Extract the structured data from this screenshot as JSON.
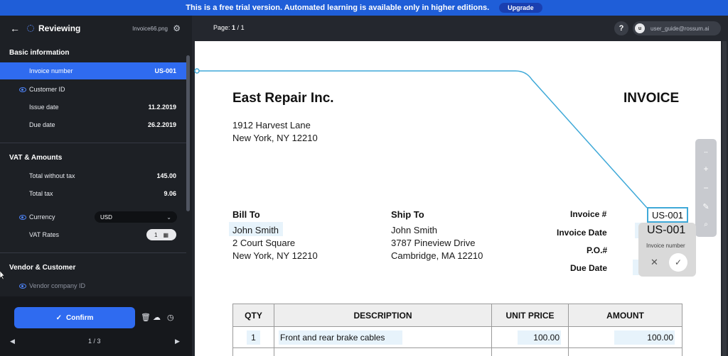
{
  "banner": {
    "text": "This is a free trial version. Automated learning is available only in higher editions.",
    "upgrade": "Upgrade"
  },
  "sidebar": {
    "title": "Reviewing",
    "filename": "Invoice66.png",
    "sections": {
      "basic": "Basic information",
      "vat": "VAT & Amounts",
      "vendor": "Vendor & Customer"
    },
    "fields": {
      "invoice_number": {
        "label": "Invoice number",
        "value": "US-001"
      },
      "customer_id": {
        "label": "Customer ID"
      },
      "issue_date": {
        "label": "Issue date",
        "value": "11.2.2019"
      },
      "due_date": {
        "label": "Due date",
        "value": "26.2.2019"
      },
      "total_wo_tax": {
        "label": "Total without tax",
        "value": "145.00"
      },
      "total_tax": {
        "label": "Total tax",
        "value": "9.06"
      },
      "currency": {
        "label": "Currency",
        "value": "USD"
      },
      "vat_rates": {
        "label": "VAT Rates",
        "value": "1"
      },
      "vendor_company_id": {
        "label": "Vendor company ID"
      }
    },
    "confirm": "Confirm",
    "pager": "1 / 3"
  },
  "docbar": {
    "page_label": "Page:",
    "page_current": "1",
    "page_total": "/ 1",
    "help": "?",
    "avatar": "u",
    "user": "user_guide@rossum.ai"
  },
  "invoice": {
    "company": "East Repair Inc.",
    "heading": "INVOICE",
    "address1": "1912 Harvest Lane",
    "address2": "New York, NY 12210",
    "bill_to": {
      "title": "Bill To",
      "name": "John Smith",
      "street": "2 Court Square",
      "city": "New York, NY 12210"
    },
    "ship_to": {
      "title": "Ship To",
      "name": "John Smith",
      "street": "3787 Pineview Drive",
      "city": "Cambridge, MA 12210"
    },
    "meta_labels": {
      "invoice_no": "Invoice #",
      "invoice_date": "Invoice Date",
      "po": "P.O.#",
      "due_date": "Due Date"
    },
    "invoice_no_value": "US-001",
    "table": {
      "headers": [
        "QTY",
        "DESCRIPTION",
        "UNIT PRICE",
        "AMOUNT"
      ],
      "rows": [
        [
          "1",
          "Front and rear brake cables",
          "100.00",
          "100.00"
        ]
      ]
    }
  },
  "edit_popup": {
    "value": "US-001",
    "label": "Invoice number"
  },
  "colors": {
    "accent": "#2f6bf0",
    "banner": "#1f5ed8",
    "connector": "#3fa9d8"
  }
}
